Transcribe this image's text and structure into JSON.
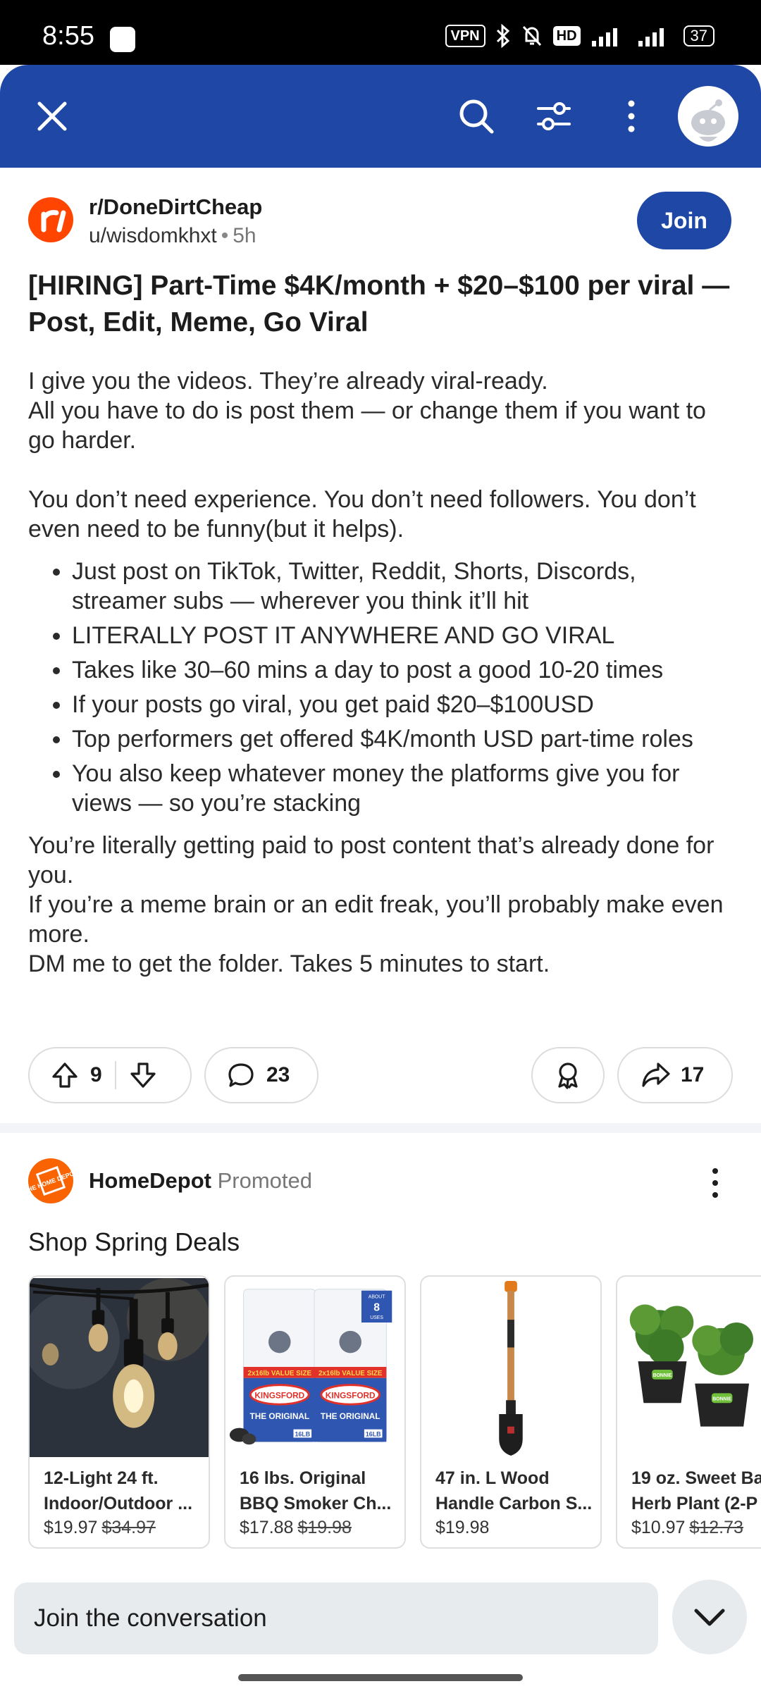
{
  "status_bar": {
    "time": "8:55",
    "vpn": "VPN",
    "hd": "HD",
    "battery": "37"
  },
  "post": {
    "subreddit": "r/DoneDirtCheap",
    "author": "u/wisdomkhxt",
    "age": "5h",
    "join_label": "Join",
    "title": "[HIRING] Part-Time $4K/month + $20–$100 per viral — Post, Edit, Meme, Go Viral",
    "paragraphs_top": [
      "I give you the videos. They’re already viral-ready.",
      "All you have to do is post them — or change them if you want to go harder.",
      "You don’t need experience. You don’t need followers. You don’t even need to be funny(but it helps)."
    ],
    "bullets": [
      "Just post on TikTok, Twitter, Reddit, Shorts, Discords, streamer subs — wherever you think it’ll hit",
      "LITERALLY POST IT ANYWHERE AND GO VIRAL",
      "Takes like 30–60 mins a day to post a good 10-20 times",
      "If your posts go viral, you get paid $20–$100USD",
      "Top performers get offered $4K/month USD part-time roles",
      "You also keep whatever money the platforms give you for views — so you’re stacking"
    ],
    "paragraphs_bottom": [
      "You’re literally getting paid to post content that’s already done for you.",
      "If you’re a meme brain or an edit freak, you’ll probably make even more.",
      "DM me to get the folder. Takes 5 minutes to start."
    ],
    "votes": "9",
    "comments": "23",
    "shares": "17"
  },
  "ad": {
    "advertiser": "HomeDepot",
    "promoted_label": "Promoted",
    "headline": "Shop Spring Deals",
    "products": [
      {
        "name_line1": "12-Light 24 ft.",
        "name_line2": "Indoor/Outdoor ...",
        "price": "$19.97",
        "was": "$34.97"
      },
      {
        "name_line1": "16 lbs. Original",
        "name_line2": "BBQ Smoker Ch...",
        "price": "$17.88",
        "was": "$19.98"
      },
      {
        "name_line1": "47 in. L Wood",
        "name_line2": "Handle Carbon S...",
        "price": "$19.98",
        "was": ""
      },
      {
        "name_line1": "19 oz. Sweet Ba",
        "name_line2": "Herb Plant (2-P",
        "price": "$10.97",
        "was": "$12.73"
      }
    ],
    "charcoal_badge": {
      "top": "ABOUT",
      "num": "8",
      "bottom": "USES"
    },
    "charcoal_value": "2x16lb VALUE SIZE",
    "charcoal_brand": "KINGSFORD",
    "charcoal_sub": "THE ORIGINAL",
    "charcoal_weight": "16LB",
    "plant_tag": "BONNIE",
    "logo_text": "THE HOME DEPOT"
  },
  "bottom": {
    "placeholder": "Join the conversation"
  },
  "colors": {
    "brand_blue": "#1f48a6",
    "reddit_orange": "#ff4500",
    "homedepot_orange": "#f96302"
  }
}
